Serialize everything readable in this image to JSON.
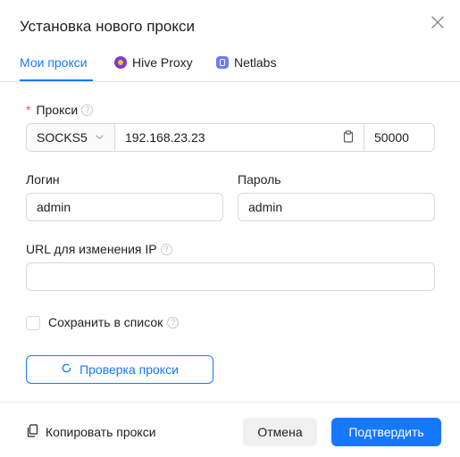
{
  "dialog": {
    "title": "Установка нового прокси"
  },
  "tabs": [
    {
      "label": "Мои прокси",
      "icon": "none",
      "active": true
    },
    {
      "label": "Hive Proxy",
      "icon": "hive-proxy-icon",
      "active": false
    },
    {
      "label": "Netlabs",
      "icon": "netlabs-icon",
      "active": false
    }
  ],
  "form": {
    "proxy": {
      "required_mark": "*",
      "label": "Прокси",
      "type": "SOCKS5",
      "host": "192.168.23.23",
      "port": "50000"
    },
    "login": {
      "label": "Логин",
      "value": "admin"
    },
    "password": {
      "label": "Пароль",
      "value": "admin"
    },
    "change_ip_url": {
      "label": "URL для изменения IP",
      "value": "",
      "placeholder": ""
    },
    "save_to_list": {
      "label": "Сохранить в список",
      "checked": false
    },
    "check_button": {
      "label": "Проверка прокси"
    }
  },
  "footer": {
    "copy_label": "Копировать прокси",
    "cancel_label": "Отмена",
    "confirm_label": "Подтвердить"
  },
  "colors": {
    "accent": "#1677ff",
    "required": "#ff4d4f",
    "border": "#d9d9d9"
  }
}
